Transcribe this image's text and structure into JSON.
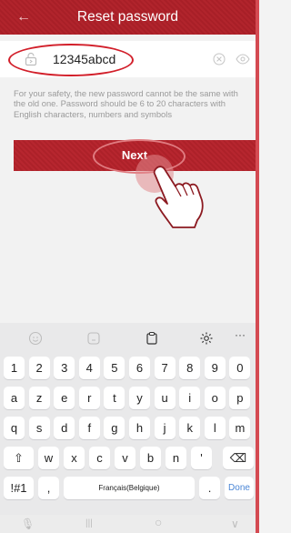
{
  "header": {
    "title": "Reset password",
    "back_icon": "back-arrow-icon"
  },
  "password": {
    "value": "12345abcd",
    "placeholder": ""
  },
  "hint": "For your safety, the new password cannot be the same with the old one. Password should be 6 to 20 characters with English characters, numbers and symbols",
  "actions": {
    "next_label": "Next"
  },
  "keyboard": {
    "toolbar": [
      "smiley-icon",
      "sticker-icon",
      "clipboard-icon",
      "settings-icon",
      "more-icon"
    ],
    "more": "···",
    "row1": [
      "1",
      "2",
      "3",
      "4",
      "5",
      "6",
      "7",
      "8",
      "9",
      "0"
    ],
    "row2": [
      "a",
      "z",
      "e",
      "r",
      "t",
      "y",
      "u",
      "i",
      "o",
      "p"
    ],
    "row3": [
      "q",
      "s",
      "d",
      "f",
      "g",
      "h",
      "j",
      "k",
      "l",
      "m"
    ],
    "row4": [
      "⇧",
      "w",
      "x",
      "c",
      "v",
      "b",
      "n",
      "'",
      "⌫"
    ],
    "row5": {
      "symbols": "!#1",
      "comma": ",",
      "space": "Français(Belgique)",
      "period": ".",
      "done": "Done"
    }
  },
  "navbar": {
    "mic": "🎙",
    "recents": "|||",
    "home": "○",
    "back": "∨"
  },
  "colors": {
    "brand": "#b1242c",
    "annotation": "#d21f2a",
    "done": "#4a86d6"
  }
}
